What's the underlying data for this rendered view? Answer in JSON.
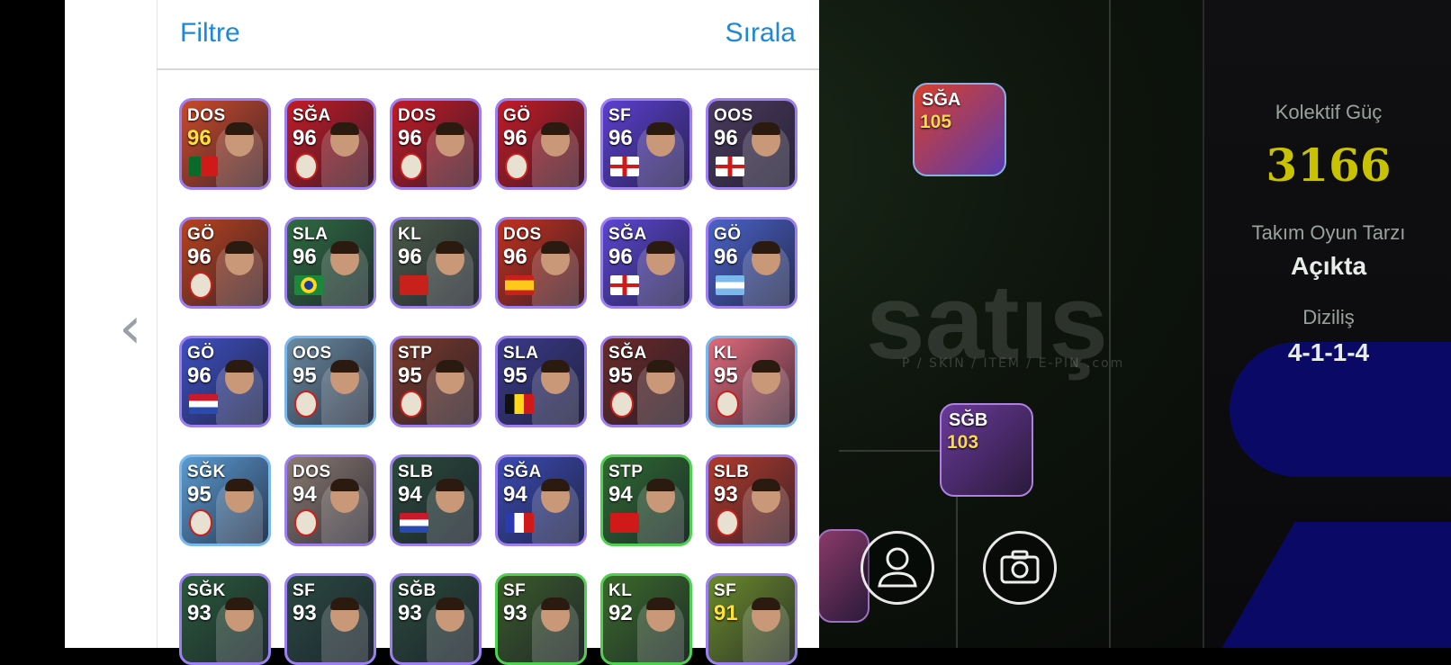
{
  "panel": {
    "filter_label": "Filtre",
    "sort_label": "Sırala"
  },
  "team": {
    "power_label": "Kolektif Güç",
    "power_value": "3166",
    "style_label": "Takım Oyun Tarzı",
    "style_value": "Açıkta",
    "formation_label": "Diziliş",
    "formation_value": "4-1-1-4"
  },
  "watermark": {
    "text": "satış",
    "sub": "P / SKIN / ITEM / E-PIN .com"
  },
  "field_cards": [
    {
      "position": "SĞA",
      "rating": "105"
    },
    {
      "position": "SĞB",
      "rating": "103"
    }
  ],
  "players": [
    {
      "position": "DOS",
      "rating": "96",
      "bg": "#c94a2a",
      "flag": "portugal-flag-icon",
      "rating_color": "#ffe23a"
    },
    {
      "position": "SĞA",
      "rating": "96",
      "bg": "#c21b26",
      "flag": "arsenal-badge-icon",
      "rating_color": "#ffffff"
    },
    {
      "position": "DOS",
      "rating": "96",
      "bg": "#c21b26",
      "flag": "arsenal-badge-icon",
      "rating_color": "#ffffff"
    },
    {
      "position": "GÖ",
      "rating": "96",
      "bg": "#c21b26",
      "flag": "arsenal-badge-icon",
      "rating_color": "#ffffff"
    },
    {
      "position": "SF",
      "rating": "96",
      "bg": "#5b3fcf",
      "flag": "england-flag-icon",
      "rating_color": "#ffffff"
    },
    {
      "position": "OOS",
      "rating": "96",
      "bg": "#4a3a5c",
      "flag": "england-flag-icon",
      "rating_color": "#ffffff"
    },
    {
      "position": "GÖ",
      "rating": "96",
      "bg": "#b8421e",
      "flag": "barcelona-badge-icon",
      "rating_color": "#ffffff"
    },
    {
      "position": "SLA",
      "rating": "96",
      "bg": "#2f6a40",
      "flag": "brazil-flag-icon",
      "rating_color": "#ffffff"
    },
    {
      "position": "KL",
      "rating": "96",
      "bg": "#4a5a48",
      "flag": "morocco-flag-icon",
      "rating_color": "#ffffff"
    },
    {
      "position": "DOS",
      "rating": "96",
      "bg": "#c0301e",
      "flag": "spain-flag-icon",
      "rating_color": "#ffffff"
    },
    {
      "position": "SĞA",
      "rating": "96",
      "bg": "#5a46d0",
      "flag": "england-flag-icon",
      "rating_color": "#ffffff"
    },
    {
      "position": "GÖ",
      "rating": "96",
      "bg": "#4a62c8",
      "flag": "argentina-flag-icon",
      "rating_color": "#ffffff"
    },
    {
      "position": "GÖ",
      "rating": "96",
      "bg": "#3d4fc0",
      "flag": "netherlands-flag-icon",
      "rating_color": "#ffffff"
    },
    {
      "position": "OOS",
      "rating": "95",
      "bg": "#6a8aa0",
      "flag": "inter-badge-icon",
      "rating_color": "#ffffff"
    },
    {
      "position": "STP",
      "rating": "95",
      "bg": "#7a3a2a",
      "flag": "psg-badge-icon",
      "rating_color": "#ffffff"
    },
    {
      "position": "SLA",
      "rating": "95",
      "bg": "#3a3a8a",
      "flag": "belgium-flag-icon",
      "rating_color": "#ffffff"
    },
    {
      "position": "SĞA",
      "rating": "95",
      "bg": "#6a2a28",
      "flag": "roma-badge-icon",
      "rating_color": "#ffffff"
    },
    {
      "position": "KL",
      "rating": "95",
      "bg": "#e06a7a",
      "flag": "fin-badge-icon",
      "rating_color": "#ffffff"
    },
    {
      "position": "SĞK",
      "rating": "95",
      "bg": "#5a9ad0",
      "flag": "fcb-badge-icon",
      "rating_color": "#ffffff"
    },
    {
      "position": "DOS",
      "rating": "94",
      "bg": "#8a7a70",
      "flag": "manutd-badge-icon",
      "rating_color": "#ffffff"
    },
    {
      "position": "SLB",
      "rating": "94",
      "bg": "#2a4a3a",
      "flag": "netherlands-flag-icon",
      "rating_color": "#ffffff"
    },
    {
      "position": "SĞA",
      "rating": "94",
      "bg": "#3a4ab0",
      "flag": "france-flag-icon",
      "rating_color": "#ffffff"
    },
    {
      "position": "STP",
      "rating": "94",
      "bg": "#2e6a30",
      "flag": "switzerland-flag-icon",
      "rating_color": "#ffffff"
    },
    {
      "position": "SLB",
      "rating": "93",
      "bg": "#b03a2a",
      "flag": "sheffield-badge-icon",
      "rating_color": "#ffffff"
    },
    {
      "position": "SĞK",
      "rating": "93",
      "bg": "#2a5a3a",
      "flag": "",
      "rating_color": "#ffffff"
    },
    {
      "position": "SF",
      "rating": "93",
      "bg": "#2a4a40",
      "flag": "",
      "rating_color": "#ffffff"
    },
    {
      "position": "SĞB",
      "rating": "93",
      "bg": "#2a4a3a",
      "flag": "",
      "rating_color": "#ffffff"
    },
    {
      "position": "SF",
      "rating": "93",
      "bg": "#3a5a2a",
      "flag": "",
      "rating_color": "#ffffff"
    },
    {
      "position": "KL",
      "rating": "92",
      "bg": "#3a6a2a",
      "flag": "",
      "rating_color": "#ffffff"
    },
    {
      "position": "SF",
      "rating": "91",
      "bg": "#6a8a2a",
      "flag": "",
      "rating_color": "#ffe23a"
    }
  ]
}
